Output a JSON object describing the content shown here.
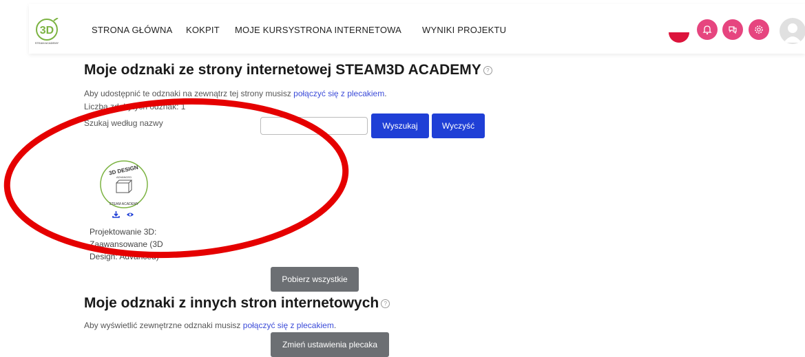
{
  "logo": {
    "text": "3D",
    "subtext": "STEAM ACADEMY"
  },
  "nav": {
    "items": [
      "STRONA GŁÓWNA",
      "KOKPIT",
      "MOJE KURSY",
      "STRONA INTERNETOWA",
      "WYNIKI PROJEKTU"
    ]
  },
  "header_icons": [
    "language-flag-pl",
    "notifications-icon",
    "messages-icon",
    "settings-icon",
    "avatar"
  ],
  "section1": {
    "title": "Moje odznaki ze strony internetowej STEAM3D ACADEMY",
    "share_text": "Aby udostępnić te odznaki na zewnątrz tej strony musisz",
    "share_link": "połączyć się z plecakiem",
    "share_end": ".",
    "count_text": "Liczba zdobytych odznak: 1",
    "search_label": "Szukaj według nazwy",
    "search_value": "",
    "search_button": "Wyszukaj",
    "clear_button": "Wyczyść",
    "badge": {
      "image_text_top": "3D DESIGN",
      "image_text_level": "ADVANCED",
      "image_text_bottom": "STEAM ACADEMY",
      "name": "Projektowanie 3D: Zaawansowane (3D Design: Advanced)"
    },
    "download_all_button": "Pobierz wszystkie"
  },
  "section2": {
    "title": "Moje odznaki z innych stron internetowych",
    "text": "Aby wyświetlić zewnętrzne odznaki musisz",
    "link": "połączyć się z plecakiem",
    "text_end": ".",
    "settings_button": "Zmień ustawienia plecaka"
  },
  "colors": {
    "accent": "#1f3fd6",
    "pink": "#e6457f",
    "grey_button": "#6c6f73",
    "annotation": "#e50000"
  }
}
